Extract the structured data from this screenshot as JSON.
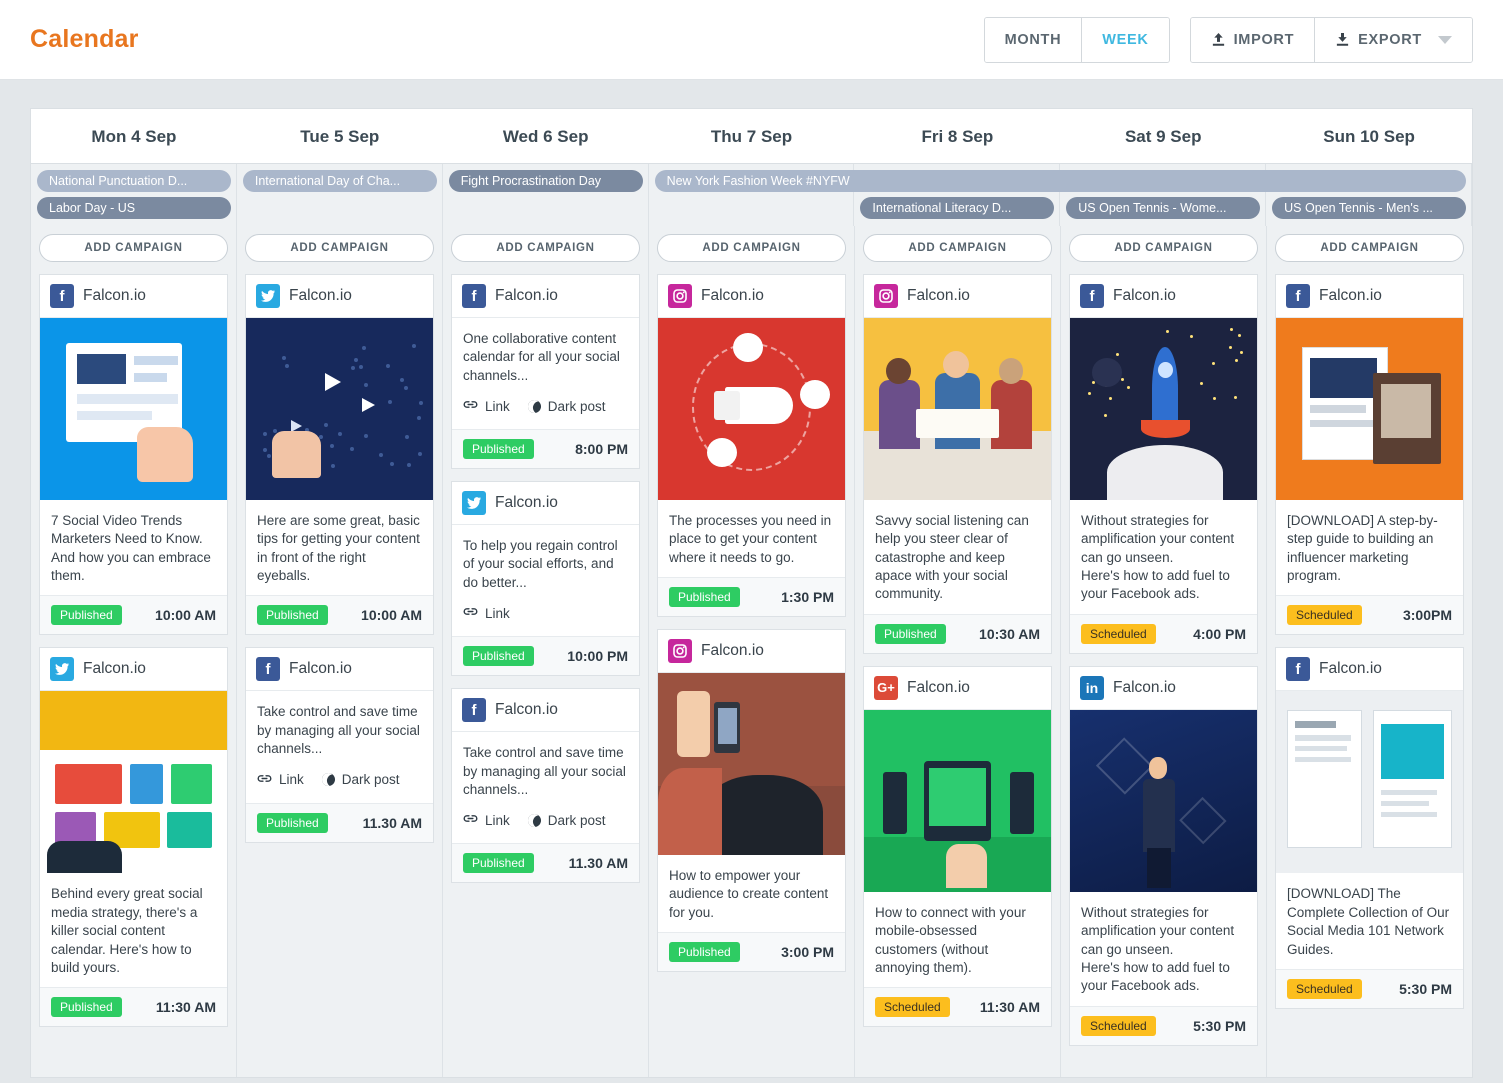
{
  "header": {
    "title": "Calendar",
    "view_toggle": {
      "month": "MONTH",
      "week": "WEEK",
      "active": "WEEK"
    },
    "import_label": "IMPORT",
    "export_label": "EXPORT",
    "accent_color": "#e8761f",
    "active_view_color": "#3fb8e0"
  },
  "labels": {
    "add_campaign": "ADD CAMPAIGN",
    "link": "Link",
    "dark_post": "Dark post",
    "profile": "Falcon.io"
  },
  "status_colors": {
    "published": "#2ecc63",
    "scheduled": "#fcbe1e"
  },
  "days": [
    {
      "label": "Mon 4 Sep"
    },
    {
      "label": "Tue 5 Sep"
    },
    {
      "label": "Wed 6 Sep"
    },
    {
      "label": "Thu 7 Sep"
    },
    {
      "label": "Fri 8 Sep"
    },
    {
      "label": "Sat 9 Sep"
    },
    {
      "label": "Sun 10 Sep"
    }
  ],
  "holidays": [
    {
      "text": "National Punctuation D...",
      "day": 0,
      "span": 1,
      "row": 0,
      "tone": "light"
    },
    {
      "text": "Labor Day - US",
      "day": 0,
      "span": 1,
      "row": 1,
      "tone": "dark"
    },
    {
      "text": "International Day of Cha...",
      "day": 1,
      "span": 1,
      "row": 0,
      "tone": "light"
    },
    {
      "text": "Fight Procrastination Day",
      "day": 2,
      "span": 1,
      "row": 0,
      "tone": "dark"
    },
    {
      "text": "New York Fashion Week #NYFW",
      "day": 3,
      "span": 4,
      "row": 0,
      "tone": "light"
    },
    {
      "text": "International Literacy D...",
      "day": 4,
      "span": 1,
      "row": 1,
      "tone": "dark"
    },
    {
      "text": "US Open Tennis - Wome...",
      "day": 5,
      "span": 1,
      "row": 1,
      "tone": "dark"
    },
    {
      "text": "US Open Tennis - Men's ...",
      "day": 6,
      "span": 1,
      "row": 1,
      "tone": "dark"
    }
  ],
  "columns": [
    {
      "day": "Mon 4 Sep",
      "posts": [
        {
          "network": "facebook",
          "network_glyph": "f",
          "profile": "Falcon.io",
          "image": "img-blue",
          "image_alt": "social-video-illustration",
          "text": "7 Social Video Trends Marketers Need to Know. And how you can embrace them.",
          "attachments": [],
          "status": "Published",
          "status_type": "published",
          "time": "10:00 AM"
        },
        {
          "network": "twitter",
          "network_glyph": "t",
          "profile": "Falcon.io",
          "image": "img-yellow",
          "image_alt": "content-calendar-illustration",
          "text": "Behind every great social media strategy, there's a killer social content calendar. Here's how to build yours.",
          "attachments": [],
          "status": "Published",
          "status_type": "published",
          "time": "11:30 AM"
        }
      ]
    },
    {
      "day": "Tue 5 Sep",
      "posts": [
        {
          "network": "twitter",
          "network_glyph": "t",
          "profile": "Falcon.io",
          "image": "img-navy",
          "image_alt": "world-map-paper-planes-illustration",
          "text": "Here are some great, basic tips for getting your content in front of the right eyeballs.",
          "attachments": [],
          "status": "Published",
          "status_type": "published",
          "time": "10:00 AM"
        },
        {
          "network": "facebook",
          "network_glyph": "f",
          "profile": "Falcon.io",
          "image": null,
          "image_alt": null,
          "text": "Take control and save time by managing all your social channels...",
          "attachments": [
            "Link",
            "Dark post"
          ],
          "status": "Published",
          "status_type": "published",
          "time": "11.30 AM"
        }
      ]
    },
    {
      "day": "Wed 6 Sep",
      "posts": [
        {
          "network": "facebook",
          "network_glyph": "f",
          "profile": "Falcon.io",
          "image": null,
          "image_alt": null,
          "text": "One collaborative content calendar for all your social channels...",
          "attachments": [
            "Link",
            "Dark post"
          ],
          "status": "Published",
          "status_type": "published",
          "time": "8:00 PM"
        },
        {
          "network": "twitter",
          "network_glyph": "t",
          "profile": "Falcon.io",
          "image": null,
          "image_alt": null,
          "text": "To help you regain control of your social efforts, and do better...",
          "attachments": [
            "Link"
          ],
          "status": "Published",
          "status_type": "published",
          "time": "10:00 PM"
        },
        {
          "network": "facebook",
          "network_glyph": "f",
          "profile": "Falcon.io",
          "image": null,
          "image_alt": null,
          "text": "Take control and save time by managing all your social channels...",
          "attachments": [
            "Link",
            "Dark post"
          ],
          "status": "Published",
          "status_type": "published",
          "time": "11.30 AM"
        }
      ]
    },
    {
      "day": "Thu 7 Sep",
      "posts": [
        {
          "network": "instagram",
          "network_glyph": "ig",
          "profile": "Falcon.io",
          "image": "img-red",
          "image_alt": "megaphone-content-process-illustration",
          "text": "The processes you need in place to get your content where it needs to go.",
          "attachments": [],
          "status": "Published",
          "status_type": "published",
          "time": "1:30 PM"
        },
        {
          "network": "instagram",
          "network_glyph": "ig",
          "profile": "Falcon.io",
          "image": "img-street",
          "image_alt": "crowd-filming-phone-photo",
          "text": "How to empower your audience to create content for you.",
          "attachments": [],
          "status": "Published",
          "status_type": "published",
          "time": "3:00 PM"
        }
      ]
    },
    {
      "day": "Fri 8 Sep",
      "posts": [
        {
          "network": "instagram",
          "network_glyph": "ig",
          "profile": "Falcon.io",
          "image": "img-paper",
          "image_alt": "three-people-reading-photo",
          "text": "Savvy social listening can help you steer clear of catastrophe and keep apace with your social community.",
          "attachments": [],
          "status": "Published",
          "status_type": "published",
          "time": "10:30 AM"
        },
        {
          "network": "googleplus",
          "network_glyph": "G+",
          "profile": "Falcon.io",
          "image": "img-green",
          "image_alt": "mobile-devices-illustration",
          "text": "How to connect with your mobile-obsessed customers (without annoying them).",
          "attachments": [],
          "status": "Scheduled",
          "status_type": "scheduled",
          "time": "11:30 AM"
        }
      ]
    },
    {
      "day": "Sat 9 Sep",
      "posts": [
        {
          "network": "facebook",
          "network_glyph": "f",
          "profile": "Falcon.io",
          "image": "img-space",
          "image_alt": "rocket-launch-illustration",
          "text": "Without strategies for amplification your content can go unseen.\nHere's how to add fuel to your Facebook ads.",
          "attachments": [],
          "status": "Scheduled",
          "status_type": "scheduled",
          "time": "4:00 PM"
        },
        {
          "network": "linkedin",
          "network_glyph": "in",
          "profile": "Falcon.io",
          "image": "img-stage",
          "image_alt": "keynote-speaker-stage-photo",
          "text": "Without strategies for amplification your content can go unseen.\nHere's how to add fuel to your Facebook ads.",
          "attachments": [],
          "status": "Scheduled",
          "status_type": "scheduled",
          "time": "5:30 PM"
        }
      ]
    },
    {
      "day": "Sun 10 Sep",
      "posts": [
        {
          "network": "facebook",
          "network_glyph": "f",
          "profile": "Falcon.io",
          "image": "img-orange",
          "image_alt": "influencer-marketing-handbook-cover",
          "text": "[DOWNLOAD] A step-by-step guide to building an influencer marketing program.",
          "attachments": [],
          "status": "Scheduled",
          "status_type": "scheduled",
          "time": "3:00PM"
        },
        {
          "network": "facebook",
          "network_glyph": "f",
          "profile": "Falcon.io",
          "image": "img-doc",
          "image_alt": "social-media-101-guides-brochure",
          "text": "[DOWNLOAD] The Complete Collection of Our Social Media 101 Network Guides.",
          "attachments": [],
          "status": "Scheduled",
          "status_type": "scheduled",
          "time": "5:30 PM"
        }
      ]
    }
  ]
}
